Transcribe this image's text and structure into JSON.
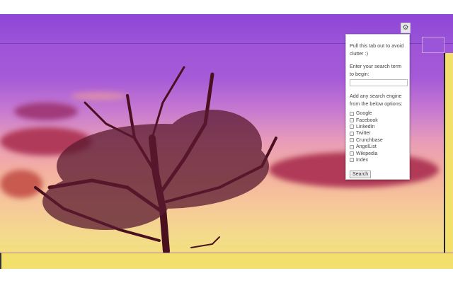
{
  "popup": {
    "intro": "Pull this tab out to avoid clutter :)",
    "prompt": "Enter your search term to begin:",
    "search_value": "",
    "engines_label": "Add any search engine from the below options:",
    "options": [
      "Google",
      "Facebook",
      "LinkedIn",
      "Twitter",
      "Crunchbase",
      "AngelList",
      "Wikipedia",
      "Index"
    ],
    "search_button": "Search"
  },
  "extension_icon": "puzzle-gear-icon"
}
